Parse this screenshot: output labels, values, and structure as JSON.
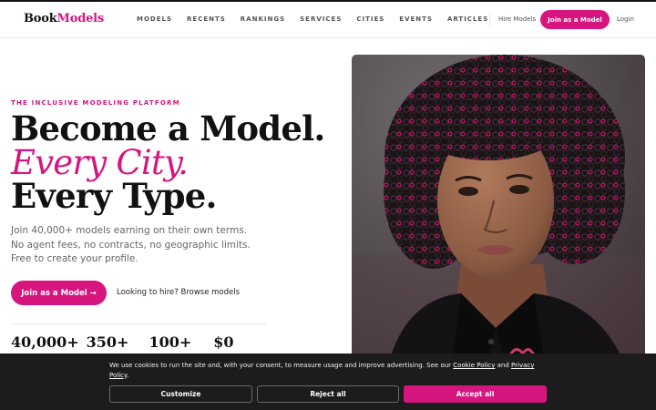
{
  "brand": {
    "name_part1": "Book",
    "name_part2": "Models",
    "accent": "#d6157f"
  },
  "nav": {
    "items": [
      "MODELS",
      "RECENTS",
      "RANKINGS",
      "SERVICES",
      "CITIES",
      "EVENTS",
      "ARTICLES"
    ],
    "hire_label": "Hire Models",
    "join_label": "Join as a Model",
    "login_label": "Login"
  },
  "hero": {
    "eyebrow": "THE INCLUSIVE MODELING PLATFORM",
    "headline_line1": "Become a Model.",
    "headline_line2": "Every City.",
    "headline_line3": "Every Type.",
    "subtext": "Join 40,000+ models earning on their own terms. No agent fees, no contracts, no geographic limits. Free to create your profile.",
    "cta_label": "Join as a Model →",
    "secondary_link": "Looking to hire? Browse models",
    "stats": [
      "40,000+",
      "350+",
      "100+",
      "$0"
    ],
    "image_icon": "portrait-photo"
  },
  "cookie_banner": {
    "text_before": "We use cookies to run the site and, with your consent, to measure usage and improve advertising. See our ",
    "cookie_policy_label": "Cookie Policy",
    "text_middle": " and ",
    "privacy_policy_label": "Privacy Policy",
    "text_after": ".",
    "customize_label": "Customize",
    "reject_label": "Reject all",
    "accept_label": "Accept all"
  }
}
